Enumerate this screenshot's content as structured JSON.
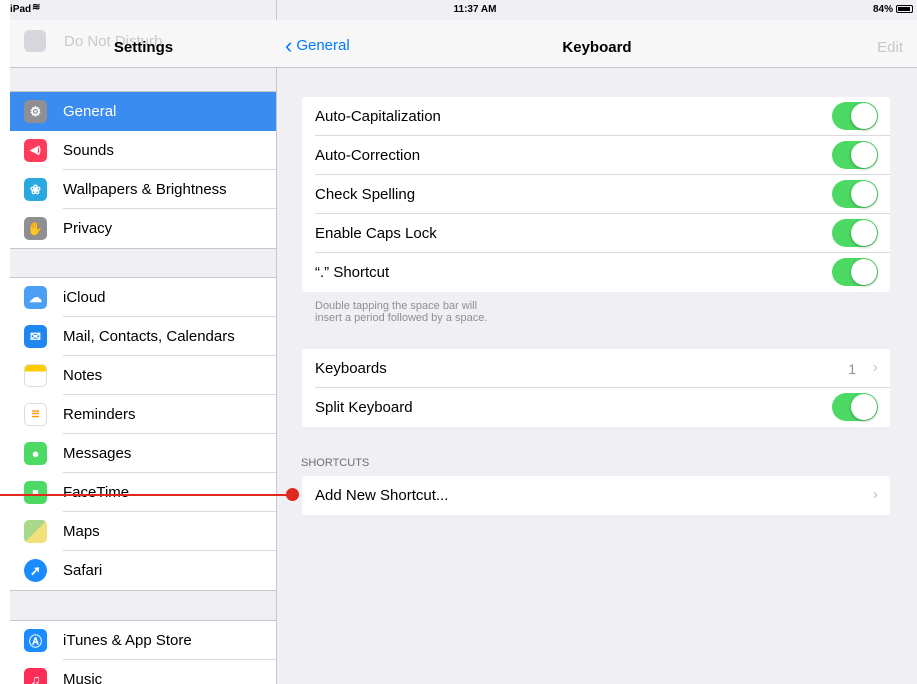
{
  "status_bar": {
    "device": "iPad",
    "wifi_icon": "wifi-icon",
    "time": "11:37 AM",
    "battery": "84%"
  },
  "sidebar": {
    "title": "Settings",
    "ghost_item": "Do Not Disturb",
    "groups": [
      [
        {
          "label": "General",
          "icon": "gear-icon",
          "color": "#8e8e93",
          "selected": true
        },
        {
          "label": "Sounds",
          "icon": "speaker-icon",
          "color": "#ff3b5c"
        },
        {
          "label": "Wallpapers & Brightness",
          "icon": "flower-icon",
          "color": "#2aa9e0"
        },
        {
          "label": "Privacy",
          "icon": "hand-icon",
          "color": "#8e8e93"
        }
      ],
      [
        {
          "label": "iCloud",
          "icon": "cloud-icon",
          "color": "#4a9ff5"
        },
        {
          "label": "Mail, Contacts, Calendars",
          "icon": "envelope-icon",
          "color": "#1e88f0"
        },
        {
          "label": "Notes",
          "icon": "notes-icon",
          "color": "#ffcc00"
        },
        {
          "label": "Reminders",
          "icon": "list-icon",
          "color": "#ffffff"
        },
        {
          "label": "Messages",
          "icon": "speech-bubble-icon",
          "color": "#4cd964"
        },
        {
          "label": "FaceTime",
          "icon": "video-camera-icon",
          "color": "#4cd964"
        },
        {
          "label": "Maps",
          "icon": "map-icon",
          "color": "#7fbf6a"
        },
        {
          "label": "Safari",
          "icon": "compass-icon",
          "color": "#1a8cff"
        }
      ],
      [
        {
          "label": "iTunes & App Store",
          "icon": "app-store-icon",
          "color": "#1a8cff"
        },
        {
          "label": "Music",
          "icon": "music-note-icon",
          "color": "#ff2d55"
        }
      ]
    ]
  },
  "nav": {
    "back_label": "General",
    "title": "Keyboard",
    "edit_label": "Edit"
  },
  "keyboard": {
    "toggles": [
      {
        "label": "Auto-Capitalization",
        "on": true
      },
      {
        "label": "Auto-Correction",
        "on": true
      },
      {
        "label": "Check Spelling",
        "on": true
      },
      {
        "label": "Enable Caps Lock",
        "on": true
      },
      {
        "label": "“.” Shortcut",
        "on": true
      }
    ],
    "footnote_line1": "Double tapping the space bar will",
    "footnote_line2": "insert a period followed by a space.",
    "keyboards_label": "Keyboards",
    "keyboards_count": "1",
    "split_label": "Split Keyboard",
    "split_on": true,
    "shortcuts_header": "SHORTCUTS",
    "add_shortcut_label": "Add New Shortcut..."
  },
  "accent_color": "#007aff",
  "toggle_color": "#4cd964",
  "callout_color": "#e0281e"
}
